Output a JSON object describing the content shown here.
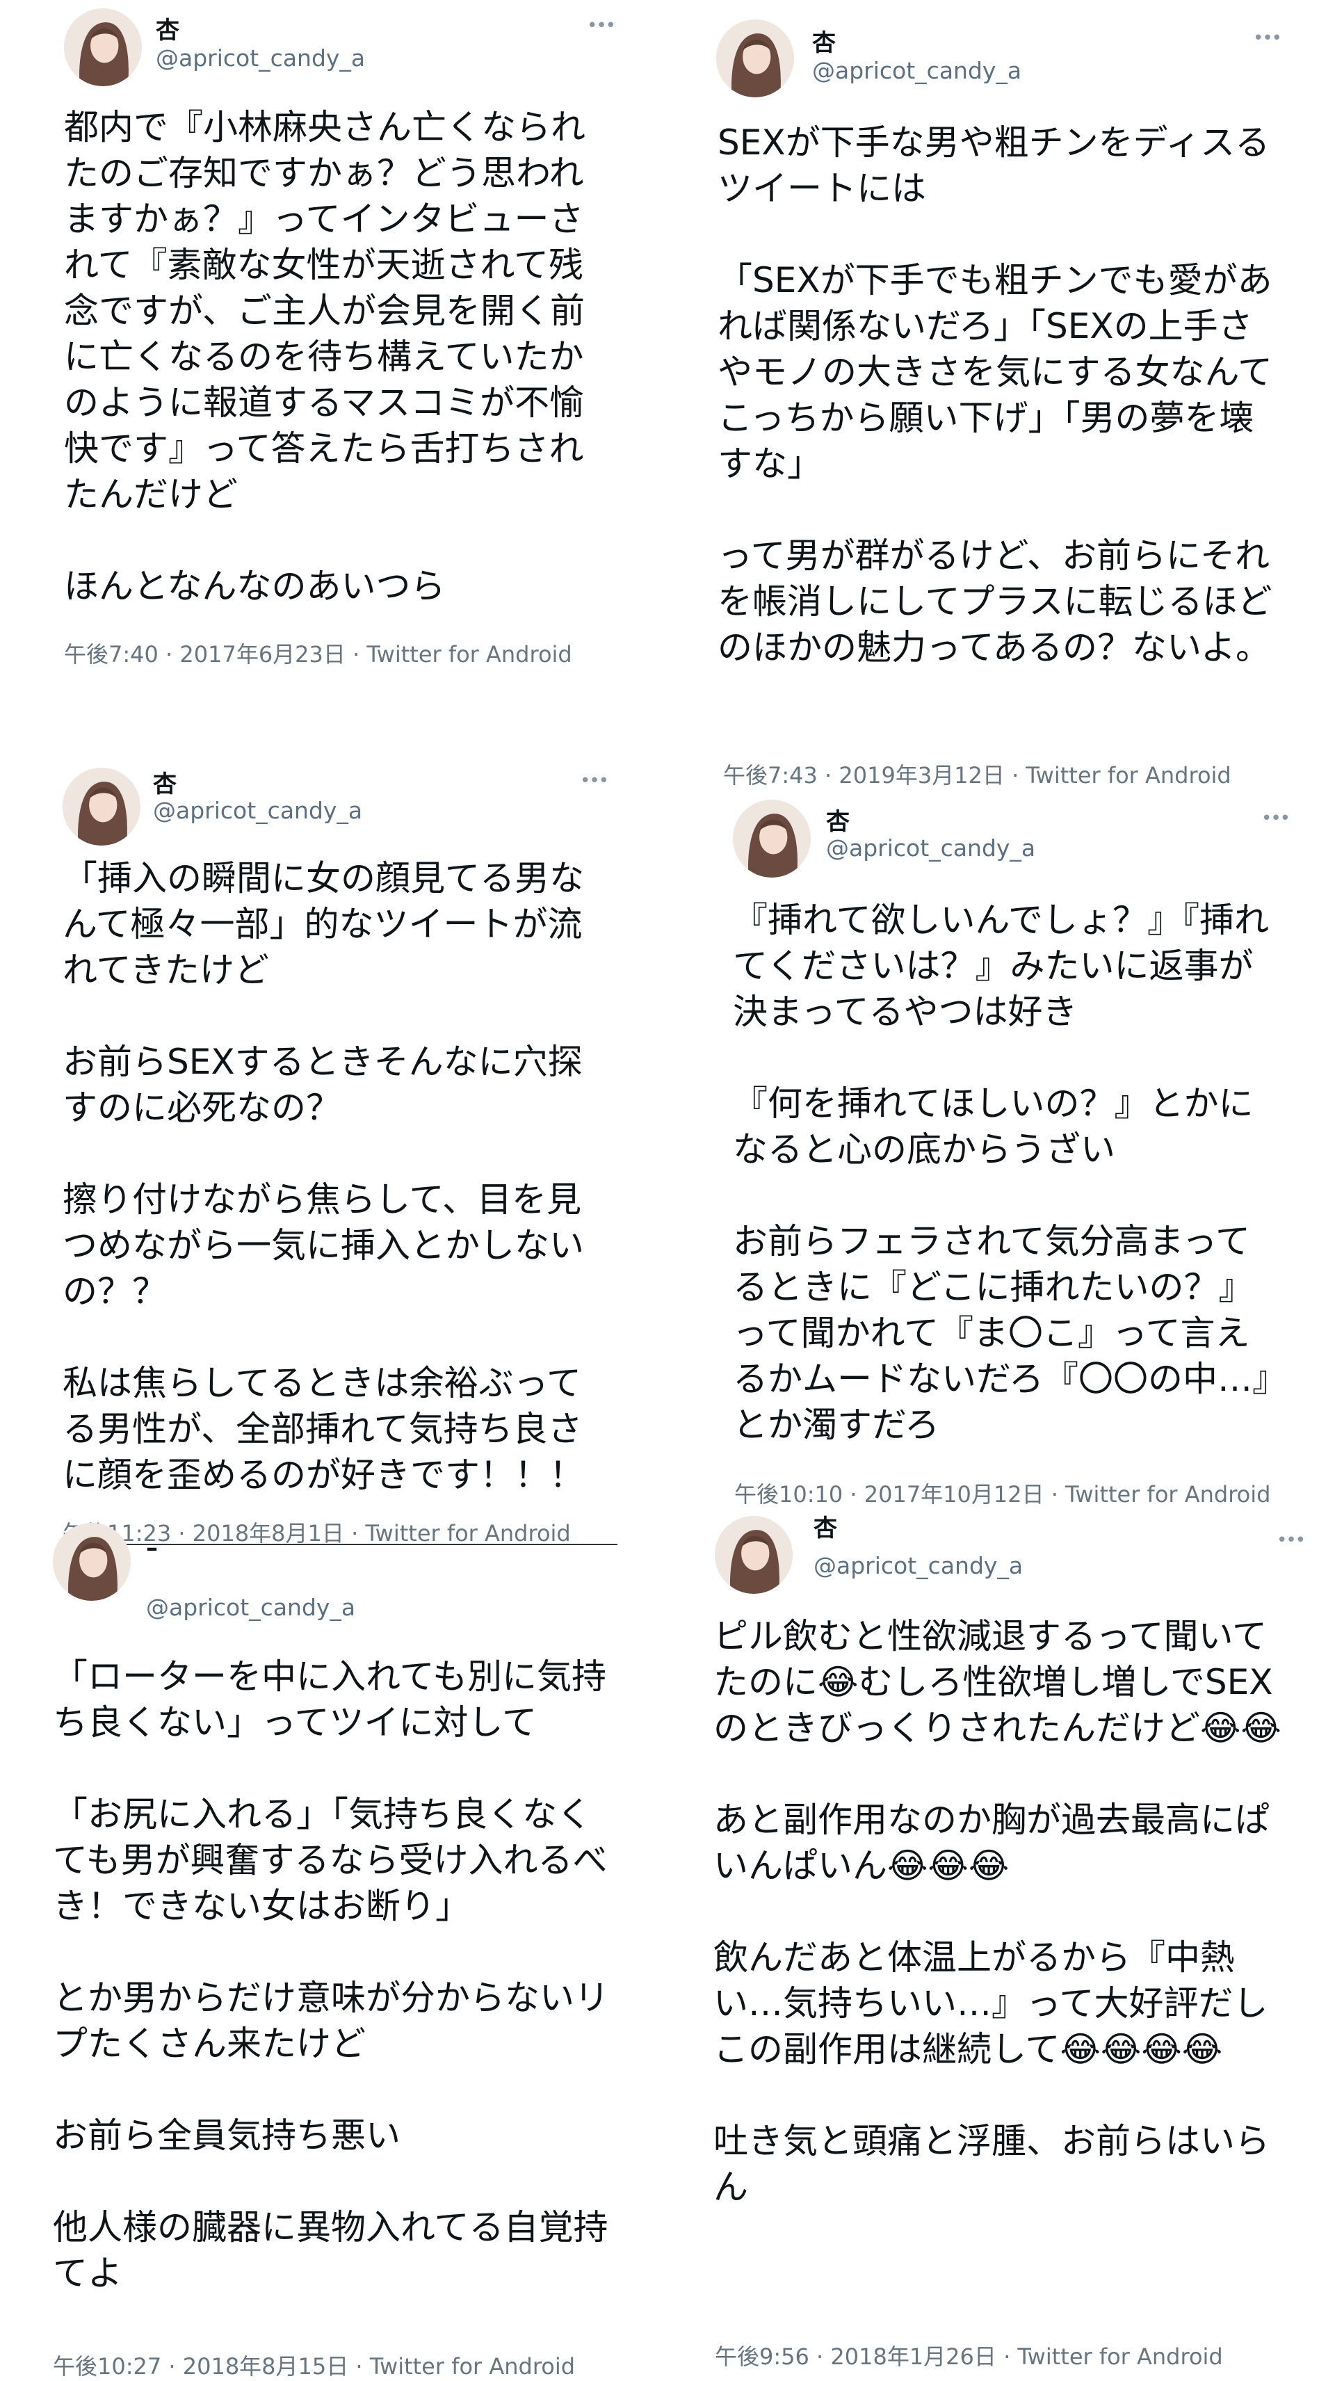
{
  "tweets": [
    {
      "name": "杏",
      "handle": "@apricot_candy_a",
      "more": "•••",
      "text": "都内で『小林麻央さん亡くなられたのご存知ですかぁ？どう思われますかぁ？』ってインタビューされて『素敵な女性が天逝されて残念ですが、ご主人が会見を開く前に亡くなるのを待ち構えていたかのように報道するマスコミが不愉快です』って答えたら舌打ちされたんだけど\n\nほんとなんなのあいつら",
      "meta": "午後7:40 · 2017年6月23日 · Twitter for Android"
    },
    {
      "name": "杏",
      "handle": "@apricot_candy_a",
      "more": "•••",
      "text": "SEXが下手な男や粗チンをディスるツイートには\n\n「SEXが下手でも粗チンでも愛があれば関係ないだろ」「SEXの上手さやモノの大きさを気にする女なんてこっちから願い下げ」「男の夢を壊すな」\n\nって男が群がるけど、お前らにそれを帳消しにしてプラスに転じるほどのほかの魅力ってあるの？ないよ。",
      "meta": "午後7:43 · 2019年3月12日 · Twitter for Android"
    },
    {
      "name": "杏",
      "handle": "@apricot_candy_a",
      "more": "•••",
      "text": "「挿入の瞬間に女の顔見てる男なんて極々一部」的なツイートが流れてきたけど\n\nお前らSEXするときそんなに穴探すのに必死なの？\n\n擦り付けながら焦らして、目を見つめながら一気に挿入とかしないの？？\n\n私は焦らしてるときは余裕ぶってる男性が、全部挿れて気持ち良さに顔を歪めるのが好きです！！！",
      "meta": "午後11:23 · 2018年8月1日 · Twitter for Android"
    },
    {
      "name": "杏",
      "handle": "@apricot_candy_a",
      "more": "•••",
      "text": "『挿れて欲しいんでしょ？』『挿れてくださいは？』みたいに返事が決まってるやつは好き\n\n『何を挿れてほしいの？』とかになると心の底からうざい\n\nお前らフェラされて気分高まってるときに『どこに挿れたいの？』って聞かれて『ま〇こ』って言えるかムードないだろ『〇〇の中…』とか濁すだろ",
      "meta": "午後10:10 · 2017年10月12日 · Twitter for Android"
    },
    {
      "name": "–",
      "handle": "@apricot_candy_a",
      "more": "",
      "text": "「ローターを中に入れても別に気持ち良くない」ってツイに対して\n\n「お尻に入れる」「気持ち良くなくても男が興奮するなら受け入れるべき！できない女はお断り」\n\nとか男からだけ意味が分からないリプたくさん来たけど\n\nお前ら全員気持ち悪い\n\n他人様の臓器に異物入れてる自覚持てよ",
      "meta": "午後10:27 · 2018年8月15日 · Twitter for Android"
    },
    {
      "name": "杏",
      "handle": "@apricot_candy_a",
      "more": "•••",
      "text": "ピル飲むと性欲減退するって聞いてたのに😂むしろ性欲増し増しでSEXのときびっくりされたんだけど😂😂\n\nあと副作用なのか胸が過去最高にぱいんぱいん😂😂😂\n\n飲んだあと体温上がるから『中熱い…気持ちいい…』って大好評だしこの副作用は継続して😂😂😂😂\n\n吐き気と頭痛と浮腫、お前らはいらん",
      "meta": "午後9:56 · 2018年1月26日 · Twitter for Android"
    }
  ]
}
